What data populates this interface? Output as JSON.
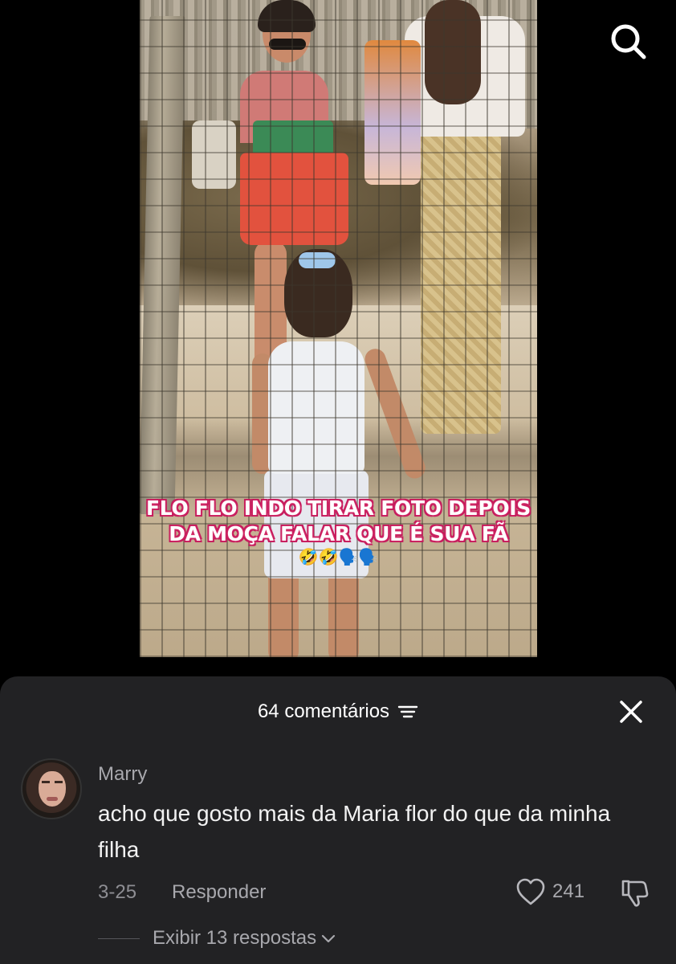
{
  "video": {
    "caption_line1": "FLO FLO INDO TIRAR FOTO DEPOIS",
    "caption_line2": "DA MOÇA FALAR QUE É SUA FÃ",
    "caption_emojis": "🤣🤣🗣️🗣️"
  },
  "top_bar": {
    "search_icon": "search-icon"
  },
  "comments_sheet": {
    "title": "64 comentários",
    "sort_icon": "sort-lines-icon",
    "close_icon": "close-icon",
    "comment": {
      "username": "Marry",
      "text": "acho que gosto mais da Maria flor do que da minha filha",
      "date": "3-25",
      "reply_label": "Responder",
      "likes": "241",
      "like_icon": "heart-outline-icon",
      "dislike_icon": "thumbs-down-icon",
      "view_replies_label": "Exibir 13 respostas"
    }
  },
  "colors": {
    "background": "#000000",
    "sheet": "#222224",
    "secondary_text": "#a8a8ad",
    "caption_outline": "#c2185b"
  }
}
